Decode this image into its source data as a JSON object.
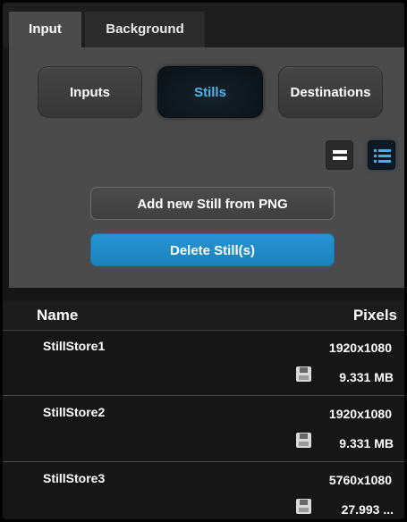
{
  "tabs": {
    "input": "Input",
    "background": "Background"
  },
  "segments": {
    "inputs": "Inputs",
    "stills": "Stills",
    "destinations": "Destinations"
  },
  "actions": {
    "add_still": "Add new Still from PNG",
    "delete_still": "Delete Still(s)"
  },
  "table": {
    "headers": {
      "name": "Name",
      "pixels": "Pixels"
    },
    "rows": [
      {
        "name": "StillStore1",
        "pixels": "1920x1080",
        "size": "9.331 MB"
      },
      {
        "name": "StillStore2",
        "pixels": "1920x1080",
        "size": "9.331 MB"
      },
      {
        "name": "StillStore3",
        "pixels": "5760x1080",
        "size": "27.993 ..."
      }
    ]
  },
  "icons": {
    "view_single": "single-view-icon",
    "view_list": "list-view-icon",
    "disk": "floppy-disk-icon"
  },
  "colors": {
    "accent": "#1f8ccb",
    "selected_text": "#4fb6ec",
    "panel_bg": "#4b4b4b",
    "list_bg": "#161616"
  }
}
